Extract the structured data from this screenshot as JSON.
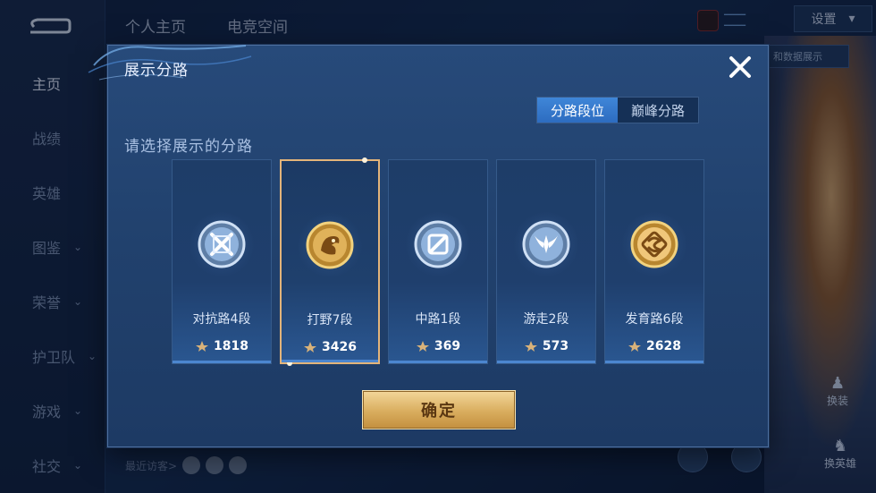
{
  "background": {
    "nav_items": [
      {
        "label": "主页",
        "active": true,
        "chevron": false
      },
      {
        "label": "战绩",
        "active": false,
        "chevron": false
      },
      {
        "label": "英雄",
        "active": false,
        "chevron": false
      },
      {
        "label": "图鉴",
        "active": false,
        "chevron": true
      },
      {
        "label": "荣誉",
        "active": false,
        "chevron": true
      },
      {
        "label": "护卫队",
        "active": false,
        "chevron": true
      },
      {
        "label": "游戏",
        "active": false,
        "chevron": true
      },
      {
        "label": "社交",
        "active": false,
        "chevron": true
      }
    ],
    "top_tabs": [
      "个人主页",
      "电竞空间"
    ],
    "settings_label": "设置",
    "data_button_label": "和数据展示",
    "side_actions": [
      "换装",
      "换英雄"
    ],
    "recent_visitors_label": "最近访客>"
  },
  "modal": {
    "title": "展示分路",
    "segments": [
      {
        "label": "分路段位",
        "active": true
      },
      {
        "label": "巅峰分路",
        "active": false
      }
    ],
    "prompt": "请选择展示的分路",
    "lanes": [
      {
        "name": "对抗路4段",
        "score": "1818",
        "emblem": "clash-lane-emblem-icon",
        "tier": "silver",
        "selected": false
      },
      {
        "name": "打野7段",
        "score": "3426",
        "emblem": "jungle-dragon-emblem-icon",
        "tier": "gold",
        "selected": true
      },
      {
        "name": "中路1段",
        "score": "369",
        "emblem": "mid-lane-emblem-icon",
        "tier": "silver",
        "selected": false
      },
      {
        "name": "游走2段",
        "score": "573",
        "emblem": "roam-wings-emblem-icon",
        "tier": "silver",
        "selected": false
      },
      {
        "name": "发育路6段",
        "score": "2628",
        "emblem": "farm-lane-emblem-icon",
        "tier": "gold",
        "selected": false
      }
    ],
    "confirm_label": "确定"
  },
  "colors": {
    "accent_blue": "#3f86d8",
    "gold": "#d9ad5e",
    "selected_border": "#e3b47a"
  }
}
